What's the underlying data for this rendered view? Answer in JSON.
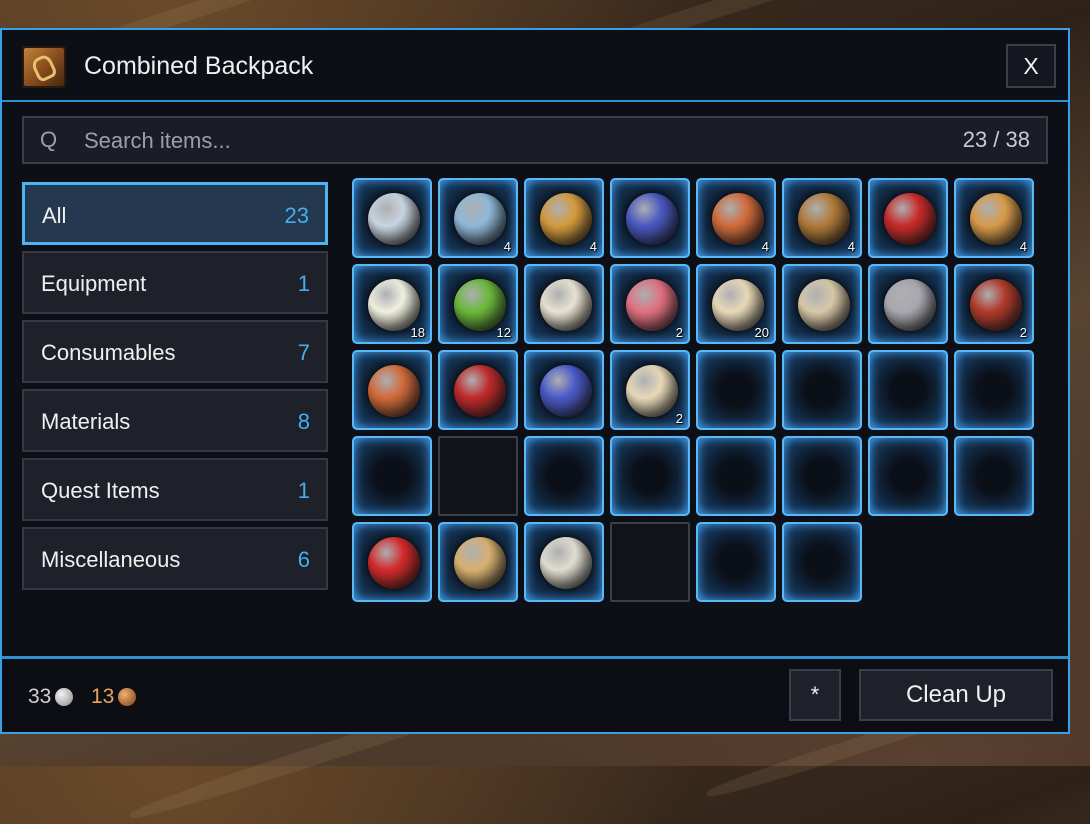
{
  "window": {
    "title": "Combined Backpack",
    "close_label": "X"
  },
  "search": {
    "icon_label": "Q",
    "placeholder": "Search items...",
    "count": "23 / 38"
  },
  "categories": [
    {
      "label": "All",
      "count": "23",
      "active": true
    },
    {
      "label": "Equipment",
      "count": "1",
      "active": false
    },
    {
      "label": "Consumables",
      "count": "7",
      "active": false
    },
    {
      "label": "Materials",
      "count": "8",
      "active": false
    },
    {
      "label": "Quest Items",
      "count": "1",
      "active": false
    },
    {
      "label": "Miscellaneous",
      "count": "6",
      "active": false
    }
  ],
  "colors": {
    "accent": "#3aa0e6",
    "count_text": "#45aef0",
    "copper": "#e7a55a"
  },
  "slots": [
    {
      "item": "silver-swirl-stone-icon",
      "color": "#c8d4e0",
      "qty": ""
    },
    {
      "item": "blue-rune-stone-icon",
      "color": "#8fb8d8",
      "qty": "4"
    },
    {
      "item": "seasoned-bread-icon",
      "color": "#d49a3c",
      "qty": "4"
    },
    {
      "item": "blue-pouch-icon",
      "color": "#4a58c0",
      "qty": ""
    },
    {
      "item": "bacon-strips-icon",
      "color": "#d06a3a",
      "qty": "4"
    },
    {
      "item": "roast-leg-icon",
      "color": "#b07a3a",
      "qty": "4"
    },
    {
      "item": "red-potion-icon",
      "color": "#c82a2a",
      "qty": ""
    },
    {
      "item": "fried-cracker-icon",
      "color": "#d89a4a",
      "qty": "4"
    },
    {
      "item": "daisy-flower-icon",
      "color": "#f0f0e0",
      "qty": "18"
    },
    {
      "item": "green-herb-leaf-icon",
      "color": "#6ab83a",
      "qty": "12"
    },
    {
      "item": "white-eggs-icon",
      "color": "#e8e2d0",
      "qty": ""
    },
    {
      "item": "raw-meat-icon",
      "color": "#e07080",
      "qty": "2"
    },
    {
      "item": "linen-cloth-icon",
      "color": "#e8d8b8",
      "qty": "20"
    },
    {
      "item": "rolled-scroll-icon",
      "color": "#d8c8a8",
      "qty": ""
    },
    {
      "item": "hand-axe-icon",
      "color": "#a8a8b0",
      "qty": ""
    },
    {
      "item": "red-feather-icon",
      "color": "#b03a2a",
      "qty": "2"
    },
    {
      "item": "bacon-strips-icon",
      "color": "#d06a3a",
      "qty": ""
    },
    {
      "item": "red-striped-feather-icon",
      "color": "#c02a2a",
      "qty": ""
    },
    {
      "item": "lightning-rune-chest-icon",
      "color": "#4a5ac8",
      "qty": ""
    },
    {
      "item": "linen-cloth-icon",
      "color": "#e8d8b8",
      "qty": "2"
    },
    {
      "item": "empty-slot-icon",
      "color": "",
      "qty": ""
    },
    {
      "item": "empty-slot-icon",
      "color": "",
      "qty": ""
    },
    {
      "item": "empty-slot-icon",
      "color": "",
      "qty": ""
    },
    {
      "item": "empty-slot-icon",
      "color": "",
      "qty": ""
    },
    {
      "item": "empty-slot-icon",
      "color": "",
      "qty": ""
    },
    {
      "item": "locked-slot",
      "color": "",
      "qty": ""
    },
    {
      "item": "empty-slot-icon",
      "color": "",
      "qty": ""
    },
    {
      "item": "empty-slot-icon",
      "color": "",
      "qty": ""
    },
    {
      "item": "empty-slot-icon",
      "color": "",
      "qty": ""
    },
    {
      "item": "empty-slot-icon",
      "color": "",
      "qty": ""
    },
    {
      "item": "empty-slot-icon",
      "color": "",
      "qty": ""
    },
    {
      "item": "empty-slot-icon",
      "color": "",
      "qty": ""
    },
    {
      "item": "red-apple-icon",
      "color": "#d42a2a",
      "qty": ""
    },
    {
      "item": "cracked-egg-icon",
      "color": "#d8b070",
      "qty": ""
    },
    {
      "item": "white-bone-shard-icon",
      "color": "#e0dcd0",
      "qty": ""
    },
    {
      "item": "locked-slot",
      "color": "",
      "qty": ""
    },
    {
      "item": "empty-slot-icon",
      "color": "",
      "qty": ""
    },
    {
      "item": "empty-slot-icon",
      "color": "",
      "qty": ""
    }
  ],
  "footer": {
    "silver": "33",
    "copper": "13",
    "silver_icon": "silver-coin-icon",
    "copper_icon": "copper-coin-icon",
    "star_label": "*",
    "cleanup_label": "Clean Up"
  }
}
